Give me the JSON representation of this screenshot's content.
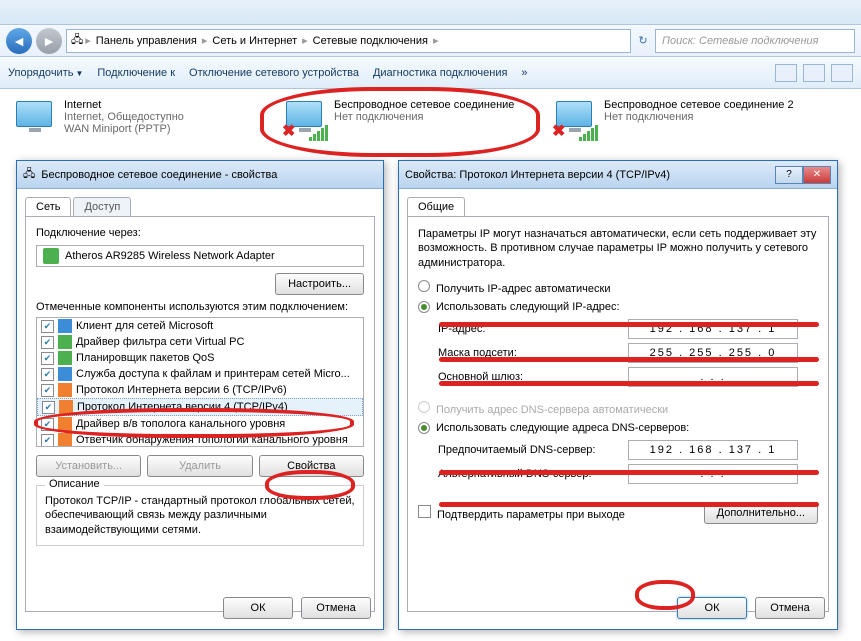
{
  "explorer": {
    "breadcrumbs": [
      "Панель управления",
      "Сеть и Интернет",
      "Сетевые подключения"
    ],
    "search_placeholder": "Поиск: Сетевые подключения",
    "toolbar": {
      "organize": "Упорядочить",
      "connect_to": "Подключение к",
      "disable_device": "Отключение сетевого устройства",
      "diagnose": "Диагностика подключения"
    }
  },
  "connections": [
    {
      "title": "Internet",
      "line2": "Internet, Общедоступно",
      "line3": "WAN Miniport (PPTP)",
      "has_x": false,
      "has_bars": false
    },
    {
      "title": "Беспроводное сетевое соединение",
      "line2": "Нет подключения",
      "line3": "",
      "has_x": true,
      "has_bars": true
    },
    {
      "title": "Беспроводное сетевое соединение 2",
      "line2": "Нет подключения",
      "line3": "",
      "has_x": true,
      "has_bars": true
    }
  ],
  "dlg_props": {
    "title": "Беспроводное сетевое соединение - свойства",
    "tabs": {
      "net": "Сеть",
      "access": "Доступ"
    },
    "connect_using": "Подключение через:",
    "adapter": "Atheros AR9285 Wireless Network Adapter",
    "configure_btn": "Настроить...",
    "components_label": "Отмеченные компоненты используются этим подключением:",
    "components": [
      "Клиент для сетей Microsoft",
      "Драйвер фильтра сети Virtual PC",
      "Планировщик пакетов QoS",
      "Служба доступа к файлам и принтерам сетей Micro...",
      "Протокол Интернета версии 6 (TCP/IPv6)",
      "Протокол Интернета версии 4 (TCP/IPv4)",
      "Драйвер в/в тополога канального уровня",
      "Ответчик обнаружения топологии канального уровня"
    ],
    "install_btn": "Установить...",
    "remove_btn": "Удалить",
    "properties_btn": "Свойства",
    "desc_title": "Описание",
    "desc_text": "Протокол TCP/IP - стандартный протокол глобальных сетей, обеспечивающий связь между различными взаимодействующими сетями.",
    "ok": "ОК",
    "cancel": "Отмена"
  },
  "dlg_ip": {
    "title": "Свойства: Протокол Интернета версии 4 (TCP/IPv4)",
    "tabs": {
      "general": "Общие"
    },
    "intro": "Параметры IP могут назначаться автоматически, если сеть поддерживает эту возможность. В противном случае параметры IP можно получить у сетевого администратора.",
    "radio_auto_ip": "Получить IP-адрес автоматически",
    "radio_manual_ip": "Использовать следующий IP-адрес:",
    "ip_label": "IP-адрес:",
    "ip_value": "192 . 168 . 137 .   1",
    "mask_label": "Маска подсети:",
    "mask_value": "255 . 255 . 255 .   0",
    "gateway_label": "Основной шлюз:",
    "gateway_value": " .       .       .  ",
    "radio_auto_dns": "Получить адрес DNS-сервера автоматически",
    "radio_manual_dns": "Использовать следующие адреса DNS-серверов:",
    "dns1_label": "Предпочитаемый DNS-сервер:",
    "dns1_value": "192 . 168 . 137 .   1",
    "dns2_label": "Альтернативный DNS-сервер:",
    "dns2_value": " .       .       .  ",
    "validate_chk": "Подтвердить параметры при выходе",
    "advanced_btn": "Дополнительно...",
    "ok": "ОК",
    "cancel": "Отмена"
  }
}
